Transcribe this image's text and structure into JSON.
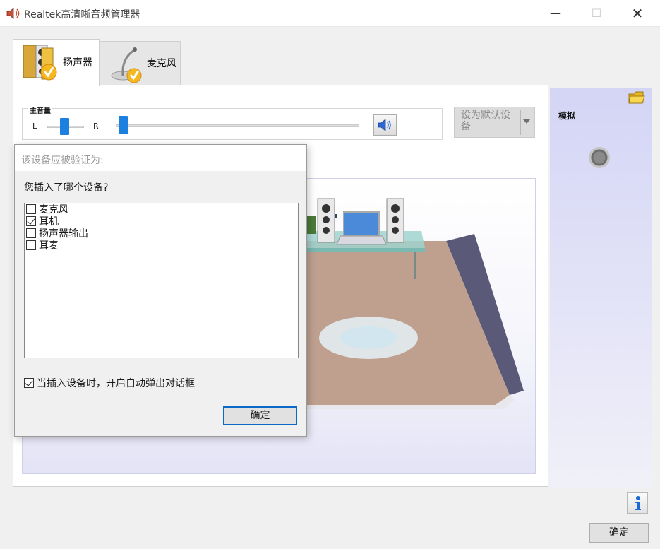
{
  "window": {
    "title": "Realtek高清晰音频管理器",
    "min": "—",
    "max": "☐",
    "close": "✕"
  },
  "tabs": [
    {
      "label": "扬声器",
      "active": true,
      "icon": "speaker-icon"
    },
    {
      "label": "麦克风",
      "active": false,
      "icon": "microphone-icon"
    }
  ],
  "volume": {
    "title": "主音量",
    "left_label": "L",
    "right_label": "R",
    "balance": 0.5,
    "level": 0.01,
    "mute_icon": "speaker-volume-icon"
  },
  "default_device": {
    "label": "设为默认设备"
  },
  "side_panel": {
    "label": "模拟",
    "folder_icon": "folder-icon",
    "jack_icon": "audio-jack-icon"
  },
  "dialog": {
    "title": "该设备应被验证为:",
    "question": "您插入了哪个设备?",
    "options": [
      {
        "label": "麦克风",
        "checked": false
      },
      {
        "label": "耳机",
        "checked": true
      },
      {
        "label": "扬声器输出",
        "checked": false
      },
      {
        "label": "耳麦",
        "checked": false
      }
    ],
    "auto_popup": {
      "label": "当插入设备时，开启自动弹出对话框",
      "checked": true
    },
    "ok": "确定"
  },
  "footer": {
    "ok": "确定",
    "info_icon": "info-icon"
  },
  "colors": {
    "accent": "#1b80e0",
    "side_panel": "#d4d5f5",
    "floor": "#bfa08f"
  }
}
